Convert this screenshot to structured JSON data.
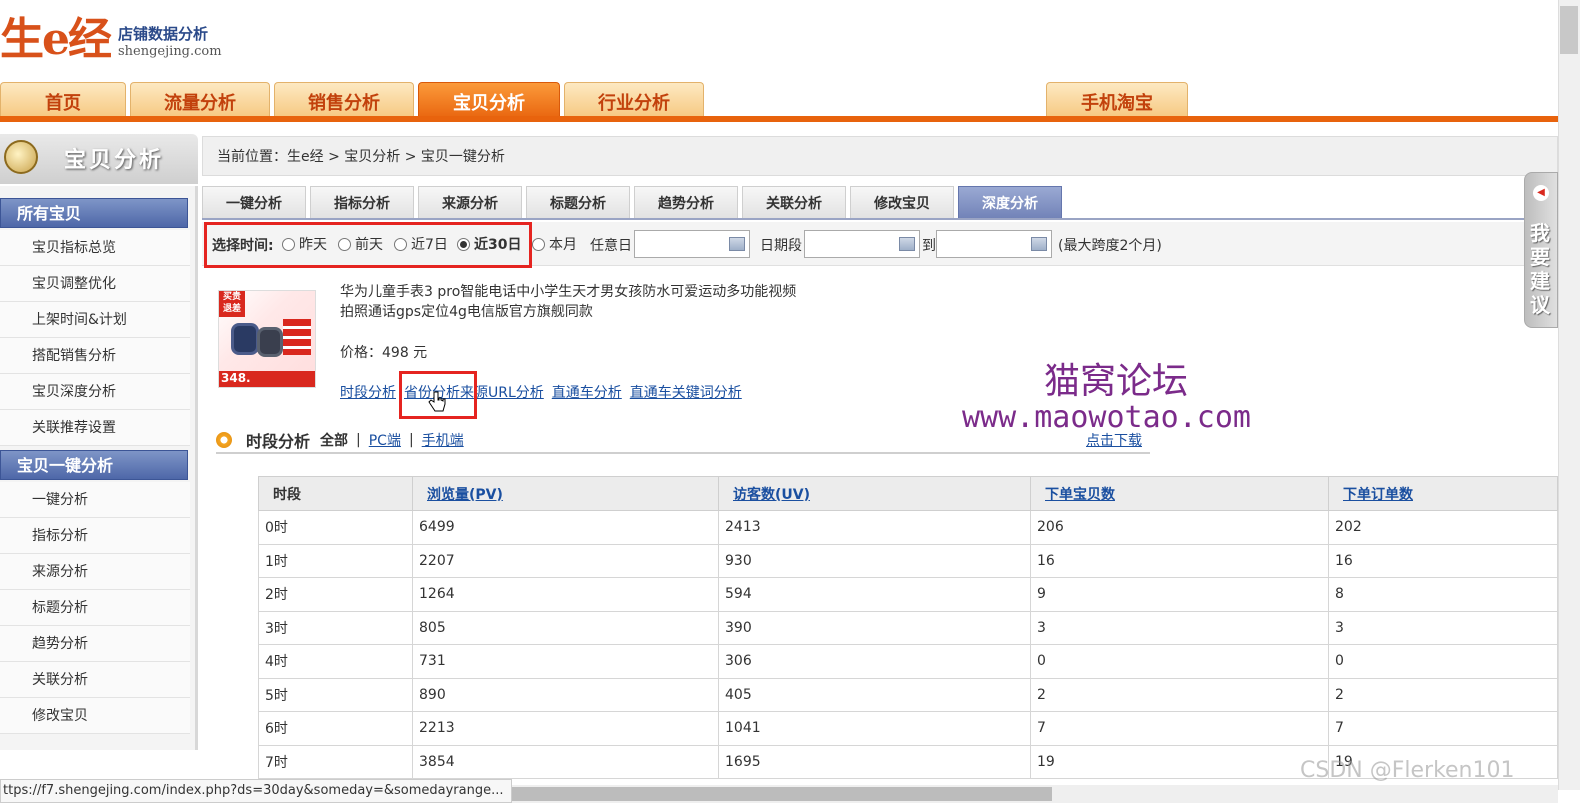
{
  "logo": {
    "mark": "生e经",
    "tagline": "店铺数据分析",
    "url": "shengejing.com"
  },
  "nav": {
    "tabs": [
      "首页",
      "流量分析",
      "销售分析",
      "宝贝分析",
      "行业分析"
    ],
    "mobile_tab": "手机淘宝",
    "active": "宝贝分析"
  },
  "sidebar": {
    "header": "宝贝分析",
    "section1": "所有宝贝",
    "section1_items": [
      "宝贝指标总览",
      "宝贝调整优化",
      "上架时间&计划",
      "搭配销售分析",
      "宝贝深度分析",
      "关联推荐设置"
    ],
    "section2": "宝贝一键分析",
    "section2_items": [
      "一键分析",
      "指标分析",
      "来源分析",
      "标题分析",
      "趋势分析",
      "关联分析",
      "修改宝贝"
    ]
  },
  "breadcrumb": "当前位置：生e经 > 宝贝分析 > 宝贝一键分析",
  "subtabs": [
    "一键分析",
    "指标分析",
    "来源分析",
    "标题分析",
    "趋势分析",
    "关联分析",
    "修改宝贝",
    "深度分析"
  ],
  "filter": {
    "label": "选择时间:",
    "options": [
      "昨天",
      "前天",
      "近7日",
      "近30日",
      "本月"
    ],
    "selected": "近30日",
    "anyday_label": "任意日",
    "period_label": "日期段",
    "to_label": "到",
    "note": "(最大跨度2个月)"
  },
  "product": {
    "title_line1": "华为儿童手表3 pro智能电话中小学生天才男女孩防水可爱运动多功能视频",
    "title_line2": "拍照通话gps定位4g电信版官方旗舰同款",
    "price": "价格：498 元",
    "img_sale": "买贵退差",
    "img_price": "348.",
    "links": [
      "时段分析",
      "省份分析",
      "来源URL分析",
      "直通车分析",
      "直通车关键词分析"
    ]
  },
  "watermark": {
    "line1": "猫窝论坛",
    "line2": "www.maowotao.com",
    "download": "点击下载"
  },
  "section": {
    "title": "时段分析",
    "all": "全部",
    "pc": "PC端",
    "mobile": "手机端",
    "separator": "|"
  },
  "table": {
    "headers": [
      "时段",
      "浏览量(PV)",
      "访客数(UV)",
      "下单宝贝数",
      "下单订单数"
    ],
    "rows": [
      [
        "0时",
        "6499",
        "2413",
        "206",
        "202"
      ],
      [
        "1时",
        "2207",
        "930",
        "16",
        "16"
      ],
      [
        "2时",
        "1264",
        "594",
        "9",
        "8"
      ],
      [
        "3时",
        "805",
        "390",
        "3",
        "3"
      ],
      [
        "4时",
        "731",
        "306",
        "0",
        "0"
      ],
      [
        "5时",
        "890",
        "405",
        "2",
        "2"
      ],
      [
        "6时",
        "2213",
        "1041",
        "7",
        "7"
      ],
      [
        "7时",
        "3854",
        "1695",
        "19",
        "19"
      ]
    ]
  },
  "feedback": "我要建议",
  "status_url": "ttps://f7.shengejing.com/index.php?ds=30day&someday=&somedayrange...",
  "credit": "CSDN @Flerken101",
  "colors": {
    "accent_orange": "#e8630d",
    "nav_blue": "#4e67a8",
    "highlight_red": "#e52420",
    "watermark_purple": "#7b2b8a"
  }
}
